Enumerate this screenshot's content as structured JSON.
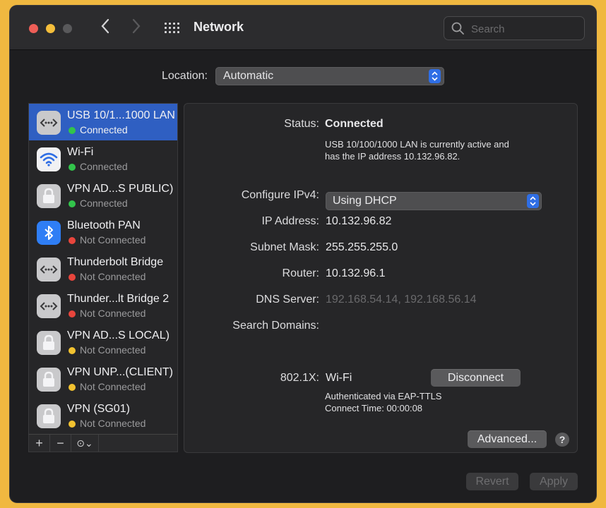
{
  "window": {
    "title": "Network"
  },
  "search": {
    "placeholder": "Search"
  },
  "location": {
    "label": "Location:",
    "value": "Automatic"
  },
  "services": [
    {
      "name": "USB 10/1...1000 LAN",
      "status": "Connected",
      "status_color": "#32c44b",
      "icon": "ethernet-icon",
      "selected": true
    },
    {
      "name": "Wi-Fi",
      "status": "Connected",
      "status_color": "#32c44b",
      "icon": "wifi-icon"
    },
    {
      "name": "VPN AD...S PUBLIC)",
      "status": "Connected",
      "status_color": "#32c44b",
      "icon": "lock-icon"
    },
    {
      "name": "Bluetooth PAN",
      "status": "Not Connected",
      "status_color": "#e8453c",
      "icon": "bluetooth-icon"
    },
    {
      "name": "Thunderbolt Bridge",
      "status": "Not Connected",
      "status_color": "#e8453c",
      "icon": "ethernet-icon"
    },
    {
      "name": "Thunder...lt Bridge 2",
      "status": "Not Connected",
      "status_color": "#e8453c",
      "icon": "ethernet-icon"
    },
    {
      "name": "VPN AD...S LOCAL)",
      "status": "Not Connected",
      "status_color": "#f2c230",
      "icon": "lock-icon"
    },
    {
      "name": "VPN UNP...(CLIENT)",
      "status": "Not Connected",
      "status_color": "#f2c230",
      "icon": "lock-icon"
    },
    {
      "name": "VPN (SG01)",
      "status": "Not Connected",
      "status_color": "#f2c230",
      "icon": "lock-icon"
    }
  ],
  "sidebar_buttons": {
    "add": "+",
    "remove": "−",
    "action": "⊙⌄"
  },
  "detail": {
    "status_label": "Status:",
    "status_value": "Connected",
    "status_desc_1": "USB 10/100/1000 LAN is currently active and",
    "status_desc_2": "has the IP address 10.132.96.82.",
    "configure_label": "Configure IPv4:",
    "configure_value": "Using DHCP",
    "ip_label": "IP Address:",
    "ip_value": "10.132.96.82",
    "subnet_label": "Subnet Mask:",
    "subnet_value": "255.255.255.0",
    "router_label": "Router:",
    "router_value": "10.132.96.1",
    "dns_label": "DNS Server:",
    "dns_value": "192.168.54.14, 192.168.56.14",
    "search_domains_label": "Search Domains:",
    "dot1x_label": "802.1X:",
    "dot1x_value": "Wi-Fi",
    "disconnect_label": "Disconnect",
    "auth_text": "Authenticated via EAP-TTLS",
    "connect_time": "Connect Time: 00:00:08",
    "advanced_label": "Advanced...",
    "help_label": "?"
  },
  "footer": {
    "revert_label": "Revert",
    "apply_label": "Apply"
  }
}
